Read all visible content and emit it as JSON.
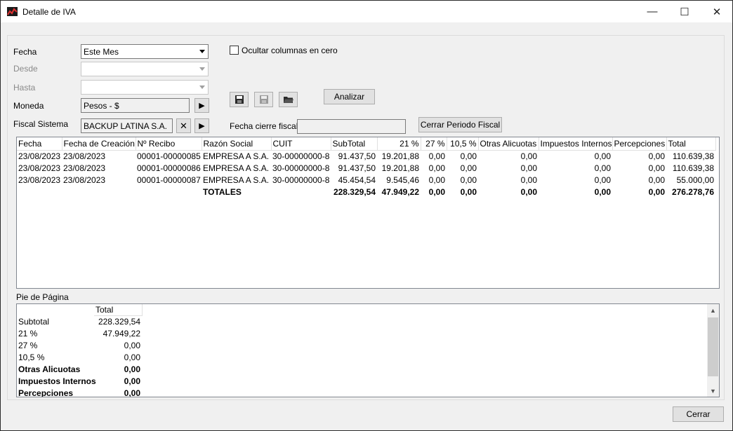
{
  "window": {
    "title": "Detalle de IVA",
    "minimize_glyph": "—",
    "maximize_glyph": "☐",
    "close_glyph": "✕"
  },
  "filters": {
    "fecha_label": "Fecha",
    "fecha_value": "Este Mes",
    "desde_label": "Desde",
    "desde_value": "",
    "hasta_label": "Hasta",
    "hasta_value": "",
    "moneda_label": "Moneda",
    "moneda_value": "Pesos - $",
    "fiscal_label": "Fiscal Sistema",
    "fiscal_value": "BACKUP LATINA S.A.",
    "ocultar_label": "Ocultar columnas en cero",
    "fecha_cierre_label": "Fecha cierre fiscal",
    "fecha_cierre_value": ""
  },
  "buttons": {
    "analizar": "Analizar",
    "cerrar_periodo": "Cerrar Periodo Fiscal",
    "cerrar": "Cerrar"
  },
  "grid": {
    "columns": [
      "Fecha",
      "Fecha de Creación",
      "Nº Recibo",
      "Razón Social",
      "CUIT",
      "SubTotal",
      "21 %",
      "27 %",
      "10,5 %",
      "Otras Alicuotas",
      "Impuestos Internos",
      "Percepciones",
      "Total"
    ],
    "rows": [
      [
        "23/08/2023",
        "23/08/2023",
        "00001-00000085",
        "EMPRESA A S.A.",
        "30-00000000-8",
        "91.437,50",
        "19.201,88",
        "0,00",
        "0,00",
        "0,00",
        "0,00",
        "0,00",
        "110.639,38"
      ],
      [
        "23/08/2023",
        "23/08/2023",
        "00001-00000086",
        "EMPRESA A S.A.",
        "30-00000000-8",
        "91.437,50",
        "19.201,88",
        "0,00",
        "0,00",
        "0,00",
        "0,00",
        "0,00",
        "110.639,38"
      ],
      [
        "23/08/2023",
        "23/08/2023",
        "00001-00000087",
        "EMPRESA A S.A.",
        "30-00000000-8",
        "45.454,54",
        "9.545,46",
        "0,00",
        "0,00",
        "0,00",
        "0,00",
        "0,00",
        "55.000,00"
      ]
    ],
    "totals": [
      "",
      "",
      "",
      "TOTALES",
      "",
      "228.329,54",
      "47.949,22",
      "0,00",
      "0,00",
      "0,00",
      "0,00",
      "0,00",
      "276.278,76"
    ]
  },
  "footer": {
    "label": "Pie de Página",
    "column": "Total",
    "rows": [
      {
        "name": "Subtotal",
        "value": "228.329,54",
        "bold": false
      },
      {
        "name": "21 %",
        "value": "47.949,22",
        "bold": false
      },
      {
        "name": "27 %",
        "value": "0,00",
        "bold": false
      },
      {
        "name": "10,5 %",
        "value": "0,00",
        "bold": false
      },
      {
        "name": "Otras Alicuotas",
        "value": "0,00",
        "bold": true
      },
      {
        "name": "Impuestos Internos",
        "value": "0,00",
        "bold": true
      },
      {
        "name": "Percepciones",
        "value": "0,00",
        "bold": true
      }
    ]
  }
}
